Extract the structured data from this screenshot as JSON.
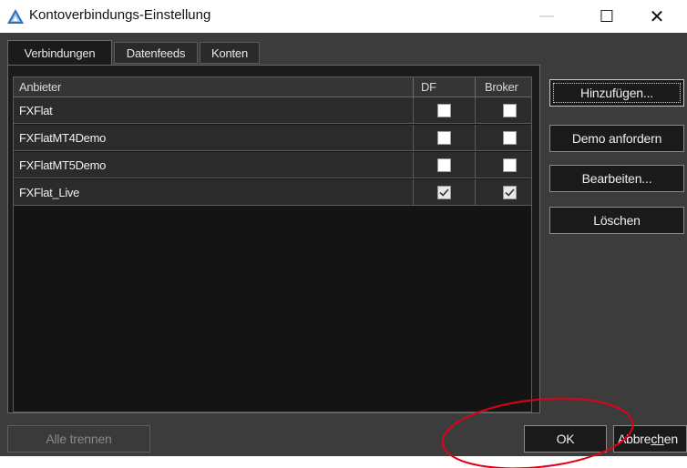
{
  "window": {
    "title": "Kontoverbindungs-Einstellung",
    "icon": "triangle-logo-icon",
    "controls": {
      "minimize": "—",
      "maximize": "☐",
      "close": "✕"
    }
  },
  "tabs": [
    {
      "label": "Verbindungen",
      "active": true
    },
    {
      "label": "Datenfeeds",
      "active": false
    },
    {
      "label": "Konten",
      "active": false
    }
  ],
  "table": {
    "columns": {
      "name": "Anbieter",
      "df": "DF",
      "broker": "Broker"
    },
    "rows": [
      {
        "name": "FXFlat",
        "df": false,
        "broker": false
      },
      {
        "name": "FXFlatMT4Demo",
        "df": false,
        "broker": false
      },
      {
        "name": "FXFlatMT5Demo",
        "df": false,
        "broker": false
      },
      {
        "name": "FXFlat_Live",
        "df": true,
        "broker": true
      }
    ]
  },
  "side_buttons": {
    "add": "Hinzufügen...",
    "demo": "Demo anfordern",
    "edit": "Bearbeiten...",
    "delete": "Löschen"
  },
  "footer": {
    "disconnect_all": "Alle trennen",
    "ok": "OK",
    "cancel_prefix": "Abbre",
    "cancel_underlined": "ch",
    "cancel_suffix": "en"
  },
  "colors": {
    "dialog_bg": "#3c3c3c",
    "table_bg": "#141414",
    "annotation": "#e0001a"
  }
}
